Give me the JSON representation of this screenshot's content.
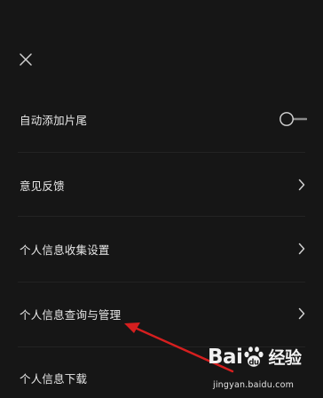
{
  "header": {
    "close_icon": "close-icon"
  },
  "settings": {
    "items": [
      {
        "label": "自动添加片尾",
        "control": "toggle",
        "toggle_on": false
      },
      {
        "label": "意见反馈",
        "control": "chevron"
      },
      {
        "label": "个人信息收集设置",
        "control": "chevron"
      },
      {
        "label": "个人信息查询与管理",
        "control": "chevron"
      },
      {
        "label": "个人信息下载",
        "control": "none"
      }
    ]
  },
  "annotation": {
    "arrow_color": "#d61f1f",
    "points_to": "个人信息查询与管理"
  },
  "watermark": {
    "logo_text_left": "Bai",
    "logo_text_right": "u",
    "logo_suffix": "经验",
    "url": "jingyan.baidu.com"
  },
  "colors": {
    "background": "#161616",
    "text": "#e8e8e8",
    "divider": "#232323",
    "icon": "#d0d0d0"
  }
}
